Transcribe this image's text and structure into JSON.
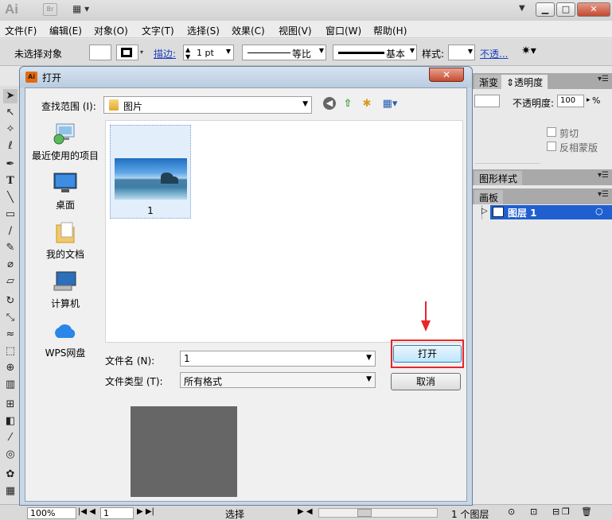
{
  "app": {
    "logo": "Ai",
    "bridge": "Br"
  },
  "menu": [
    "文件(F)",
    "编辑(E)",
    "对象(O)",
    "文字(T)",
    "选择(S)",
    "效果(C)",
    "视图(V)",
    "窗口(W)",
    "帮助(H)"
  ],
  "controlbar": {
    "selection_status": "未选择对象",
    "stroke_label": "描边:",
    "stroke_weight": "1 pt",
    "profile": "等比",
    "brush": "基本",
    "style_label": "样式:",
    "opacity_link": "不透..."
  },
  "panels": {
    "tab1": "渐变",
    "tab2": "透明度",
    "opacity_label": "不透明度:",
    "opacity_value": "100",
    "opacity_unit": "%",
    "clip_label": "剪切",
    "invert_label": "反相蒙版",
    "graphic_styles": "图形样式",
    "artboards": "画板",
    "layer_name": "图层 1",
    "layer_count": "1 个图层"
  },
  "dialog": {
    "title": "打开",
    "icon_text": "Ai",
    "lookin_label": "查找范围 (I):",
    "lookin_value": "图片",
    "places": [
      "最近使用的项目",
      "桌面",
      "我的文档",
      "计算机",
      "WPS网盘"
    ],
    "files": [
      {
        "name": "1"
      }
    ],
    "filename_label": "文件名 (N):",
    "filename_value": "1",
    "filetype_label": "文件类型 (T):",
    "filetype_value": "所有格式",
    "open_button": "打开",
    "cancel_button": "取消"
  },
  "statusbar": {
    "zoom": "100%",
    "artboard_number": "1",
    "status_text": "选择"
  },
  "colors": {
    "highlight": "#e8262a",
    "link": "#1a3fbf",
    "selected_layer": "#1f5fd0"
  }
}
